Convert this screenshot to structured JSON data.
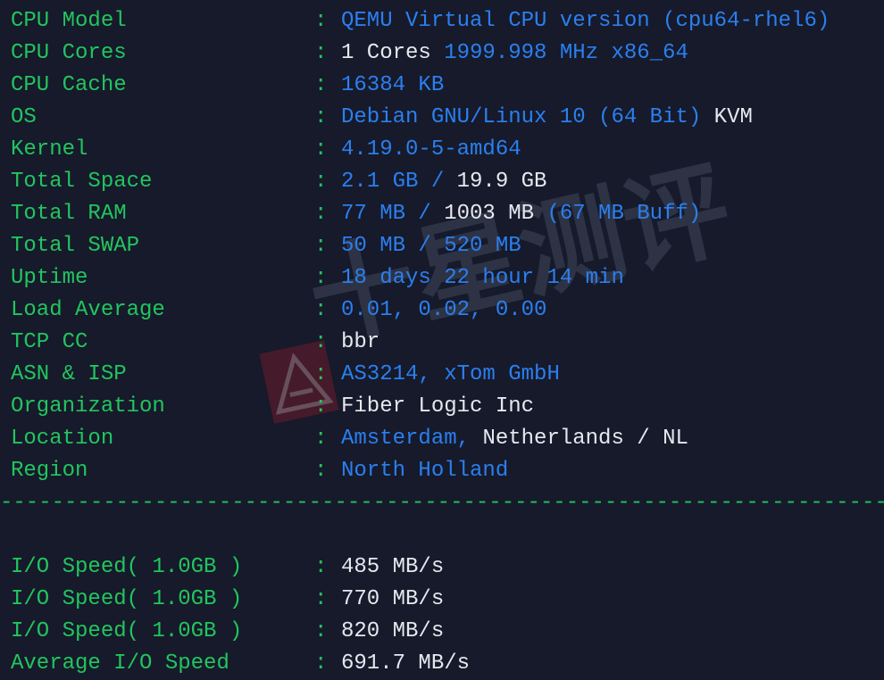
{
  "terminal": {
    "background_color": "#161A2B",
    "label_color": "#22C55E",
    "value_blue": "#2B7FEF",
    "value_white": "#E6E8EE",
    "separator": ":",
    "divider": "--------------------------------------------------------------------------------",
    "rows": [
      {
        "label": "CPU Model",
        "parts": [
          {
            "text": "QEMU Virtual CPU version (cpu64-rhel6)",
            "color": "blue"
          }
        ]
      },
      {
        "label": "CPU Cores",
        "parts": [
          {
            "text": "1 Cores ",
            "color": "white"
          },
          {
            "text": "1999.998 MHz x86_64",
            "color": "blue"
          }
        ]
      },
      {
        "label": "CPU Cache",
        "parts": [
          {
            "text": "16384 KB",
            "color": "blue"
          }
        ]
      },
      {
        "label": "OS",
        "parts": [
          {
            "text": "Debian GNU/Linux 10 (64 Bit) ",
            "color": "blue"
          },
          {
            "text": "KVM",
            "color": "white"
          }
        ]
      },
      {
        "label": "Kernel",
        "parts": [
          {
            "text": "4.19.0-5-amd64",
            "color": "blue"
          }
        ]
      },
      {
        "label": "Total Space",
        "parts": [
          {
            "text": "2.1 GB / ",
            "color": "blue"
          },
          {
            "text": "19.9 GB",
            "color": "white"
          }
        ]
      },
      {
        "label": "Total RAM",
        "parts": [
          {
            "text": "77 MB / ",
            "color": "blue"
          },
          {
            "text": "1003 MB",
            "color": "white"
          },
          {
            "text": " (67 MB Buff)",
            "color": "blue"
          }
        ]
      },
      {
        "label": "Total SWAP",
        "parts": [
          {
            "text": "50 MB / 520 MB",
            "color": "blue"
          }
        ]
      },
      {
        "label": "Uptime",
        "parts": [
          {
            "text": "18 days 22 hour 14 min",
            "color": "blue"
          }
        ]
      },
      {
        "label": "Load Average",
        "parts": [
          {
            "text": "0.01, 0.02, 0.00",
            "color": "blue"
          }
        ]
      },
      {
        "label": "TCP CC",
        "parts": [
          {
            "text": "bbr",
            "color": "white"
          }
        ]
      },
      {
        "label": "ASN & ISP",
        "parts": [
          {
            "text": "AS3214, xTom GmbH",
            "color": "blue"
          }
        ]
      },
      {
        "label": "Organization",
        "parts": [
          {
            "text": "Fiber Logic Inc",
            "color": "white"
          }
        ]
      },
      {
        "label": "Location",
        "parts": [
          {
            "text": "Amsterdam, ",
            "color": "blue"
          },
          {
            "text": "Netherlands / NL",
            "color": "white"
          }
        ]
      },
      {
        "label": "Region",
        "parts": [
          {
            "text": "North Holland",
            "color": "blue"
          }
        ]
      }
    ],
    "io_rows": [
      {
        "label": "I/O Speed( 1.0GB )",
        "parts": [
          {
            "text": "485 MB/s",
            "color": "white"
          }
        ]
      },
      {
        "label": "I/O Speed( 1.0GB )",
        "parts": [
          {
            "text": "770 MB/s",
            "color": "white"
          }
        ]
      },
      {
        "label": "I/O Speed( 1.0GB )",
        "parts": [
          {
            "text": "820 MB/s",
            "color": "white"
          }
        ]
      },
      {
        "label": "Average I/O Speed",
        "parts": [
          {
            "text": "691.7 MB/s",
            "color": "white"
          }
        ]
      }
    ]
  },
  "watermark": {
    "text": "十星测评",
    "logo_color": "#4A1B2A",
    "text_color": "#2F3546"
  }
}
